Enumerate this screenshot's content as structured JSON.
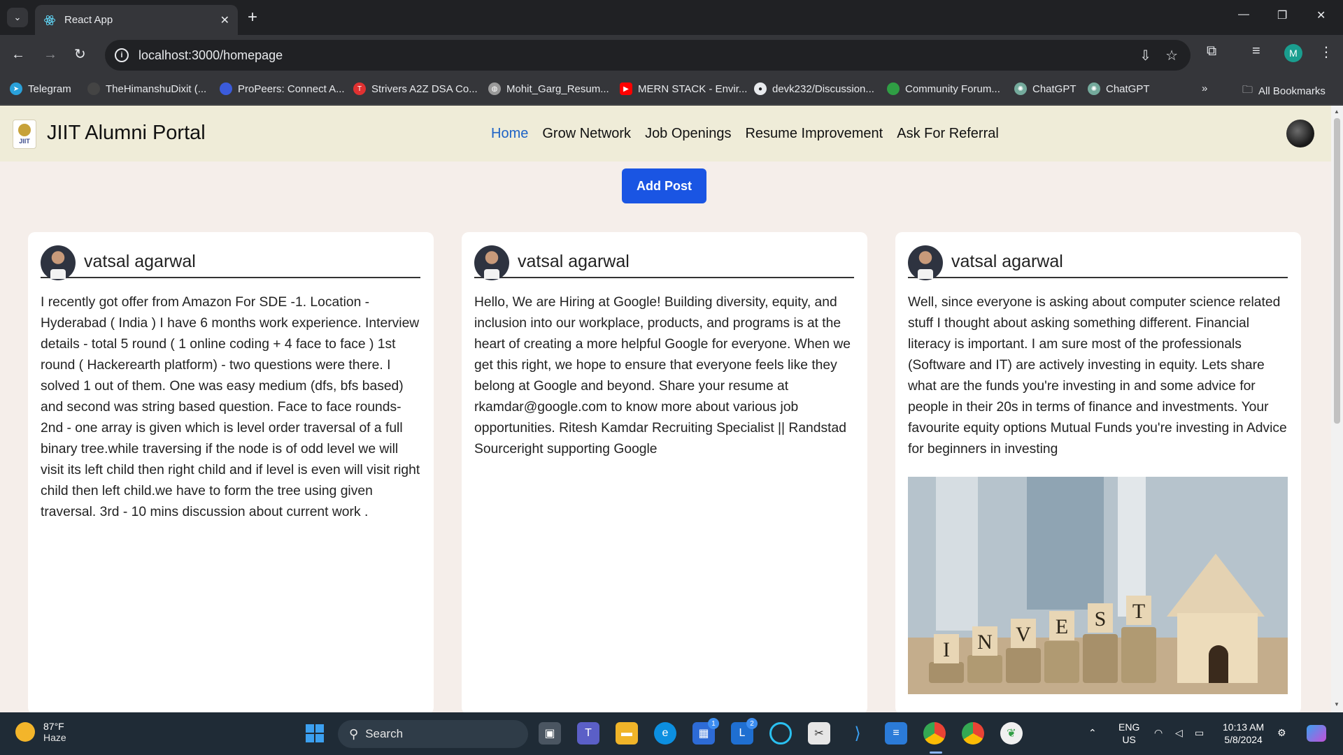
{
  "browser": {
    "tab_title": "React App",
    "url": "localhost:3000/homepage",
    "bookmarks": [
      {
        "label": "Telegram",
        "color": "#2aa1da"
      },
      {
        "label": "TheHimanshuDixit (...",
        "color": "#444444"
      },
      {
        "label": "ProPeers: Connect A...",
        "color": "#3b5bdb"
      },
      {
        "label": "Strivers A2Z DSA Co...",
        "color": "#e03131"
      },
      {
        "label": "Mohit_Garg_Resum...",
        "color": "#9a9a9a"
      },
      {
        "label": "MERN STACK - Envir...",
        "color": "#ff0000"
      },
      {
        "label": "devk232/Discussion...",
        "color": "#e8eaed"
      },
      {
        "label": "Community Forum...",
        "color": "#2f9e44"
      },
      {
        "label": "ChatGPT",
        "color": "#74aa9c"
      },
      {
        "label": "ChatGPT",
        "color": "#74aa9c"
      }
    ],
    "all_bookmarks": "All Bookmarks",
    "profile_initial": "M"
  },
  "app": {
    "brand": "JIIT Alumni Portal",
    "logo_text": "JIIT",
    "nav": [
      "Home",
      "Grow Network",
      "Job Openings",
      "Resume Improvement",
      "Ask For Referral"
    ],
    "add_post": "Add Post"
  },
  "posts": [
    {
      "author": "vatsal agarwal",
      "text": "I recently got offer from Amazon For SDE -1. Location - Hyderabad ( India ) I have 6 months work experience. Interview details - total 5 round ( 1 online coding + 4 face to face ) 1st round ( Hackerearth platform) - two questions were there. I solved 1 out of them. One was easy medium (dfs, bfs based) and second was string based question. Face to face rounds- 2nd - one array is given which is level order traversal of a full binary tree.while traversing if the node is of odd level we will visit its left child then right child and if level is even will visit right child then left child.we have to form the tree using given traversal. 3rd - 10 mins discussion about current work ."
    },
    {
      "author": "vatsal agarwal",
      "text": "Hello, We are Hiring at Google! Building diversity, equity, and inclusion into our workplace, products, and programs is at the heart of creating a more helpful Google for everyone. When we get this right, we hope to ensure that everyone feels like they belong at Google and beyond. Share your resume at rkamdar@google.com to know more about various job opportunities. Ritesh Kamdar Recruiting Specialist || Randstad Sourceright supporting Google"
    },
    {
      "author": "vatsal agarwal",
      "text": "Well, since everyone is asking about computer science related stuff I thought about asking something different. Financial literacy is important. I am sure most of the professionals (Software and IT) are actively investing in equity. Lets share what are the funds you're investing in and some advice for people in their 20s in terms of finance and investments. Your favourite equity options Mutual Funds you're investing in Advice for beginners in investing",
      "image_letters": [
        "I",
        "N",
        "V",
        "E",
        "S",
        "T"
      ]
    }
  ],
  "taskbar": {
    "temp": "87°F",
    "condition": "Haze",
    "search": "Search",
    "lang1": "ENG",
    "lang2": "US",
    "time": "10:13 AM",
    "date": "5/8/2024",
    "badge_store": "1",
    "badge_l": "2"
  }
}
